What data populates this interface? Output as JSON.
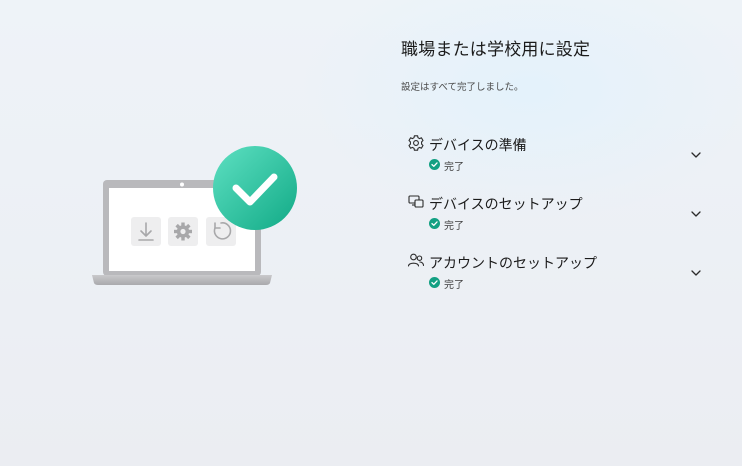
{
  "setup": {
    "title": "職場または学校用に設定",
    "subtitle": "設定はすべて完了しました。",
    "steps": [
      {
        "label": "デバイスの準備",
        "status": "完了",
        "icon": "gear-icon"
      },
      {
        "label": "デバイスのセットアップ",
        "status": "完了",
        "icon": "devices-icon"
      },
      {
        "label": "アカウントのセットアップ",
        "status": "完了",
        "icon": "people-icon"
      }
    ]
  },
  "colors": {
    "accent": "#1fbf9d",
    "status_check": "#13a083"
  }
}
